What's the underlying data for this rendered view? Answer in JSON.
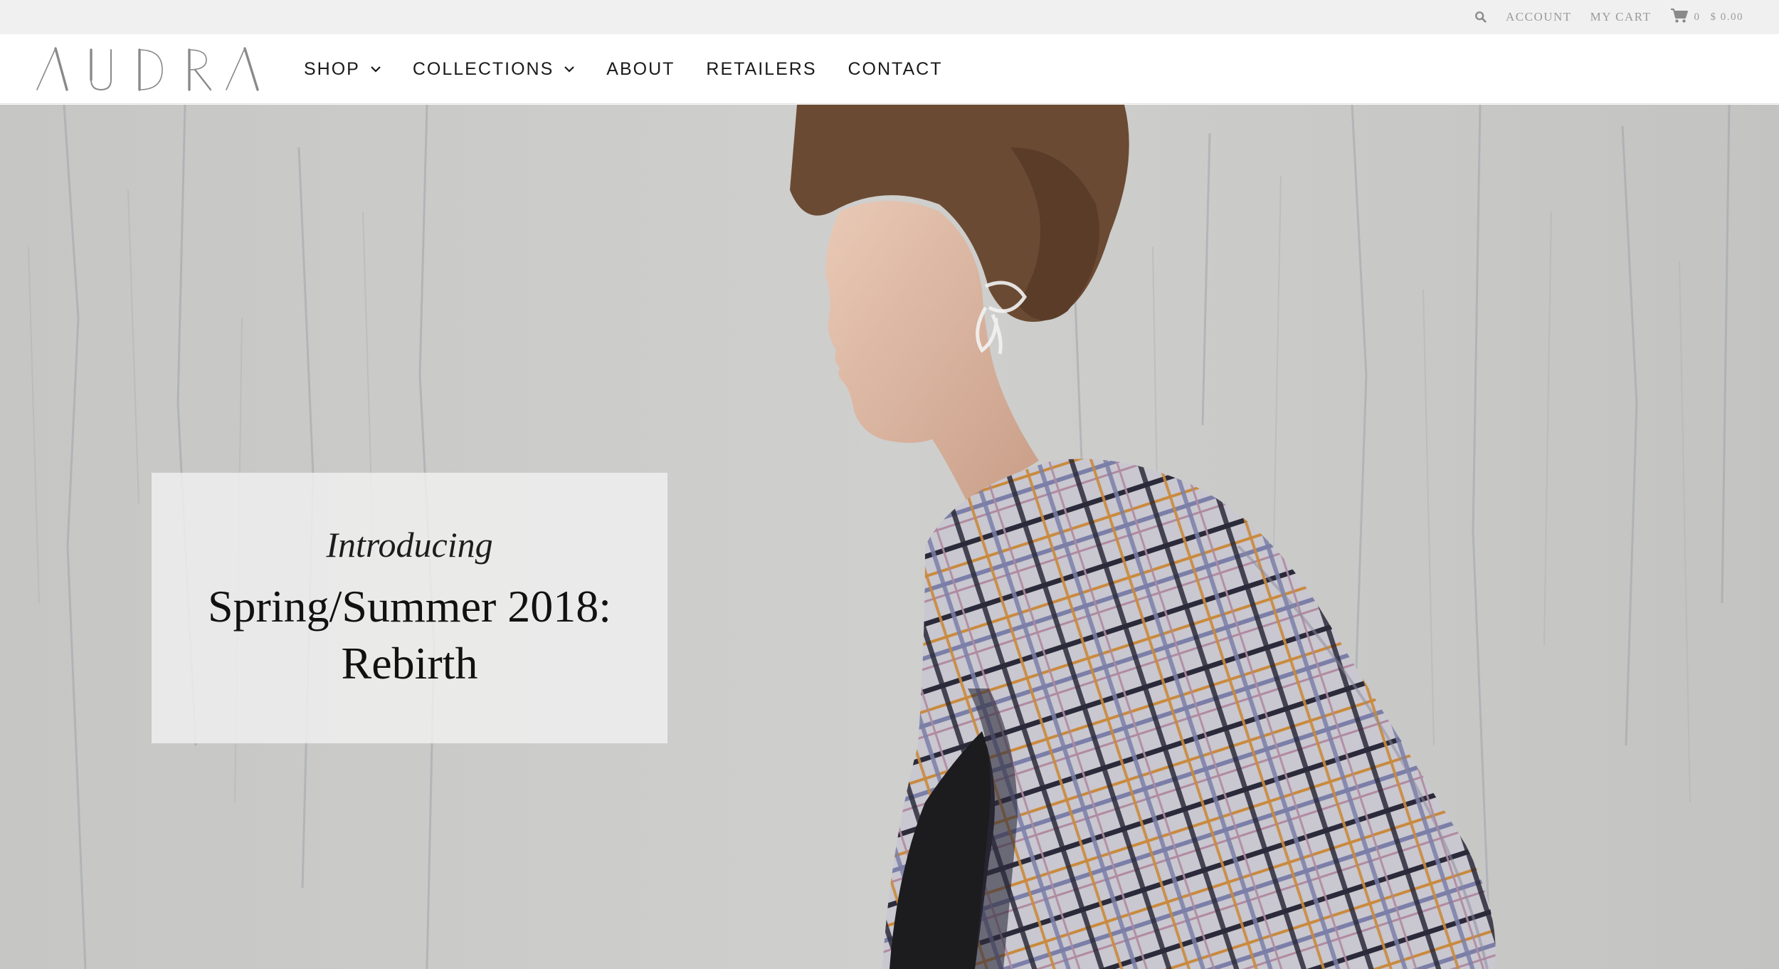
{
  "utility_bar": {
    "search_icon": "search-icon",
    "account_label": "ACCOUNT",
    "cart_label": "MY CART",
    "cart_icon": "cart-icon",
    "cart_count": "0",
    "cart_total": "$ 0.00"
  },
  "header": {
    "logo_text": "AUDRA",
    "nav": [
      {
        "label": "SHOP",
        "has_dropdown": true
      },
      {
        "label": "COLLECTIONS",
        "has_dropdown": true
      },
      {
        "label": "ABOUT",
        "has_dropdown": false
      },
      {
        "label": "RETAILERS",
        "has_dropdown": false
      },
      {
        "label": "CONTACT",
        "has_dropdown": false
      }
    ]
  },
  "hero": {
    "kicker": "Introducing",
    "title_line1": "Spring/Summer 2018:",
    "title_line2": "Rebirth"
  },
  "colors": {
    "utility_bg": "#f0f0f0",
    "utility_text": "#9a9a9a",
    "nav_text": "#1a1a1a",
    "logo": "#8a8a8a",
    "hero_wall": "#c9c9c7"
  }
}
